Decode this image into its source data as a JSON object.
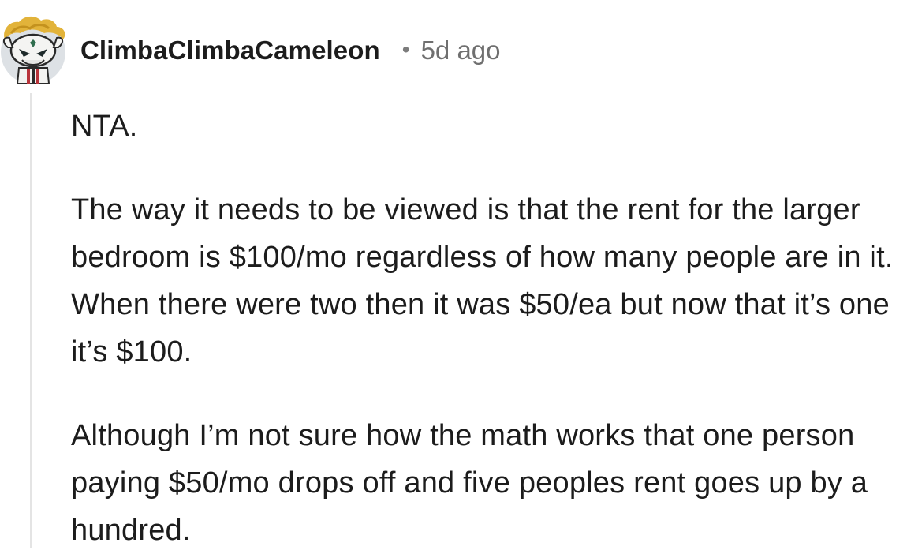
{
  "comment": {
    "username": "ClimbaClimbaCameleon",
    "separator": "•",
    "timestamp": "5d ago",
    "avatar_icon": "snoo-avatar-icon",
    "paragraphs": [
      "NTA.",
      "The way it needs to be viewed is that the rent for the larger bedroom is $100/mo regardless of how many people are in it. When there were two then it was $50/ea but now that it’s one it’s $100.",
      "Although I’m not sure how the math works that one person paying $50/mo drops off and five peoples rent goes up by a hundred."
    ]
  },
  "colors": {
    "text": "#1c1c1c",
    "meta": "#6f6f6f",
    "thread_line": "#e4e4e4",
    "avatar_bg": "#dde1e5"
  }
}
